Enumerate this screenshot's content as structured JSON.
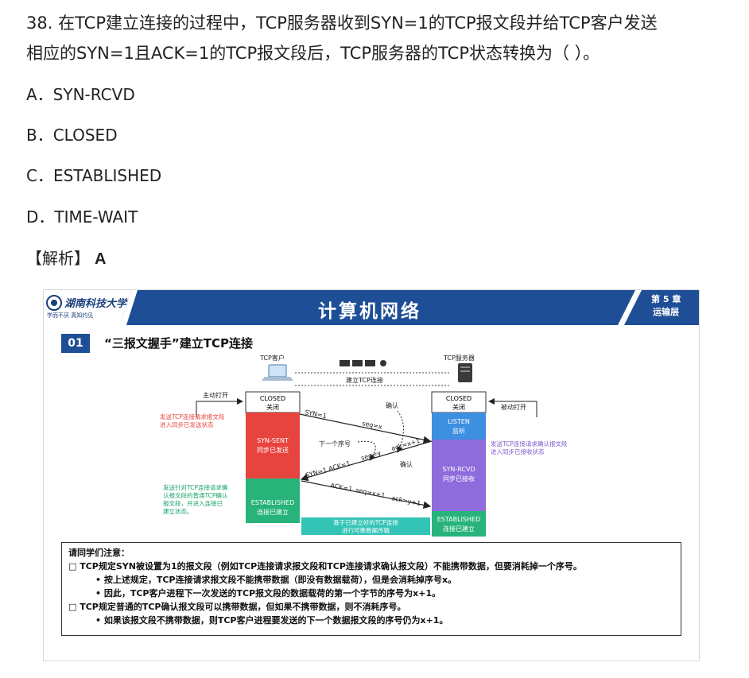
{
  "question": {
    "line1": "38. 在TCP建立连接的过程中，TCP服务器收到SYN=1的TCP报文段并给TCP客户发送",
    "line2": "相应的SYN=1且ACK=1的TCP报文段后，TCP服务器的TCP状态转换为（ ）。"
  },
  "options": [
    {
      "label": "A．SYN-RCVD"
    },
    {
      "label": "B．CLOSED"
    },
    {
      "label": "C．ESTABLISHED"
    },
    {
      "label": "D．TIME-WAIT"
    }
  ],
  "analysis": {
    "label": "【解析】",
    "answer": "A"
  },
  "slide": {
    "university": "湖南科技大学",
    "motto": "学而不厌    真知灼见",
    "course_title": "计算机网络",
    "chapter_line1": "第 5 章",
    "chapter_line2": "运输层",
    "section_number": "01",
    "section_title": "“三报文握手”建立TCP连接",
    "client_label": "TCP客户",
    "server_label": "TCP服务器",
    "connect_label": "建立TCP连接",
    "active_open": "主动打开",
    "passive_open": "被动打开",
    "client_closed_en": "CLOSED",
    "client_closed_cn": "关闭",
    "server_closed_en": "CLOSED",
    "server_closed_cn": "关闭",
    "listen_en": "LISTEN",
    "listen_cn": "监听",
    "syn_sent_en": "SYN-SENT",
    "syn_sent_cn": "同步已发送",
    "syn_rcvd_en": "SYN-RCVD",
    "syn_rcvd_cn": "同步已接收",
    "client_est_en": "ESTABLISHED",
    "client_est_cn": "连接已建立",
    "server_est_en": "ESTABLISHED",
    "server_est_cn": "连接已建立",
    "note_left1_a": "发送TCP连接请求报文段",
    "note_left1_b": "进入同步已发送状态",
    "note_right1_a": "发送TCP连接请求确认报文段",
    "note_right1_b": "进入同步已接收状态",
    "note_left2_a": "发送针对TCP连接请求确",
    "note_left2_b": "认报文段的普通TCP确认",
    "note_left2_c": "报文段，并进入连接已",
    "note_left2_d": "建立状态。",
    "msg1_syn": "SYN=1",
    "msg1_seq": "seq=x",
    "confirm1": "确认",
    "next_seq": "下一个序号",
    "msg2_flags": "SYN=1  ACK=1",
    "msg2_seq": "seq=y",
    "msg2_ack": "ack=x+1",
    "confirm2": "确认",
    "msg3_ack": "ACK=1",
    "msg3_seq": "seq=x+1",
    "msg3_acknum": "ack=y+1",
    "data_transfer_a": "基于已建立好的TCP连接",
    "data_transfer_b": "进行可靠数据传输",
    "notice_title": "请同学们注意：",
    "notice_1": "□  TCP规定SYN被设置为1的报文段（例如TCP连接请求报文段和TCP连接请求确认报文段）不能携带数据，但要消耗掉一个序号。",
    "notice_1a": "•   按上述规定，TCP连接请求报文段不能携带数据（即没有数据载荷），但是会消耗掉序号x。",
    "notice_1b": "•   因此，TCP客户进程下一次发送的TCP报文段的数据载荷的第一个字节的序号为x+1。",
    "notice_2": "□  TCP规定普通的TCP确认报文段可以携带数据，但如果不携带数据，则不消耗序号。",
    "notice_2a": "•   如果该报文段不携带数据，则TCP客户进程要发送的下一个数据报文段的序号仍为x+1。"
  },
  "colors": {
    "banner_blue": "#1e4e96",
    "red_state": "#e8443f",
    "green_state": "#27b37a",
    "blue_state": "#3d8fe0",
    "purple_state": "#8e6cdc",
    "red_text": "#e8443f",
    "green_text": "#1aa36a",
    "cyan_bar": "#34c4b6"
  }
}
